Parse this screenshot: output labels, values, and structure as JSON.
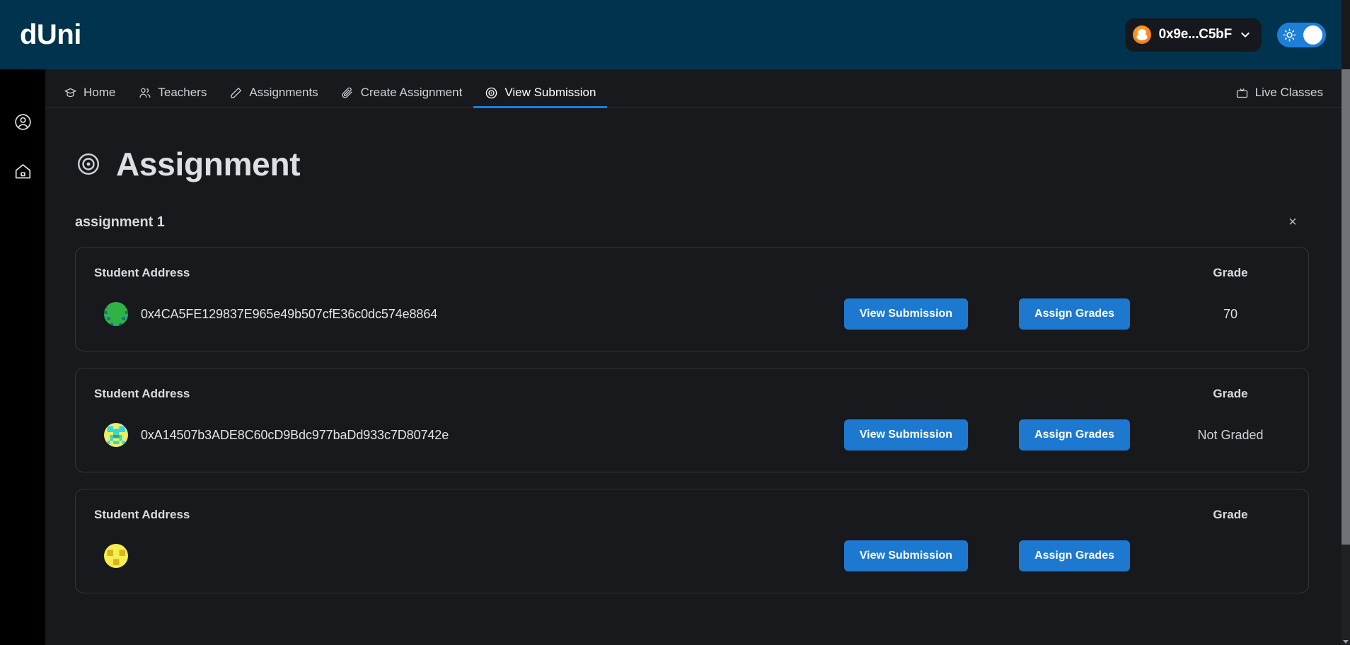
{
  "header": {
    "brand": "dUni",
    "wallet": {
      "icon": "metamask-fox-icon",
      "address": "0x9e...C5bF",
      "chevron": "chevron-down-icon"
    },
    "theme_toggle": {
      "icon": "sun-icon",
      "state": "light"
    },
    "bg_color": "#00334e"
  },
  "left_rail": {
    "items": [
      {
        "icon": "user-circle-icon",
        "name": "account"
      },
      {
        "icon": "home-icon",
        "name": "home"
      }
    ]
  },
  "nav": {
    "tabs": [
      {
        "label": "Home",
        "icon": "graduation-cap-icon",
        "active": false
      },
      {
        "label": "Teachers",
        "icon": "users-icon",
        "active": false
      },
      {
        "label": "Assignments",
        "icon": "pencil-icon",
        "active": false
      },
      {
        "label": "Create Assignment",
        "icon": "paperclip-icon",
        "active": false
      },
      {
        "label": "View Submission",
        "icon": "target-icon",
        "active": true
      }
    ],
    "right_item": {
      "label": "Live Classes",
      "icon": "tv-icon"
    },
    "active_underline_color": "#1d7fd8"
  },
  "page": {
    "title": "Assignment",
    "title_icon": "target-icon",
    "subtitle": "assignment 1",
    "close_label": "×"
  },
  "table": {
    "columns": {
      "student": "Student Address",
      "grade": "Grade"
    },
    "buttons": {
      "view": "View Submission",
      "assign": "Assign Grades"
    },
    "accent_color": "#1d78cf",
    "rows": [
      {
        "address": "0x4CA5FE129837E965e49b507cfE36c0dc574e8864",
        "grade": "70",
        "avatar_colors": [
          "#2fb344",
          "#1b5ccf"
        ]
      },
      {
        "address": "0xA14507b3ADE8C60cD9Bdc977baDd933c7D80742e",
        "grade": "Not Graded",
        "avatar_colors": [
          "#eaf062",
          "#36d6e0"
        ]
      },
      {
        "address": "",
        "grade": "",
        "avatar_colors": [
          "#f2ef4e",
          "#d8b520"
        ]
      }
    ]
  }
}
